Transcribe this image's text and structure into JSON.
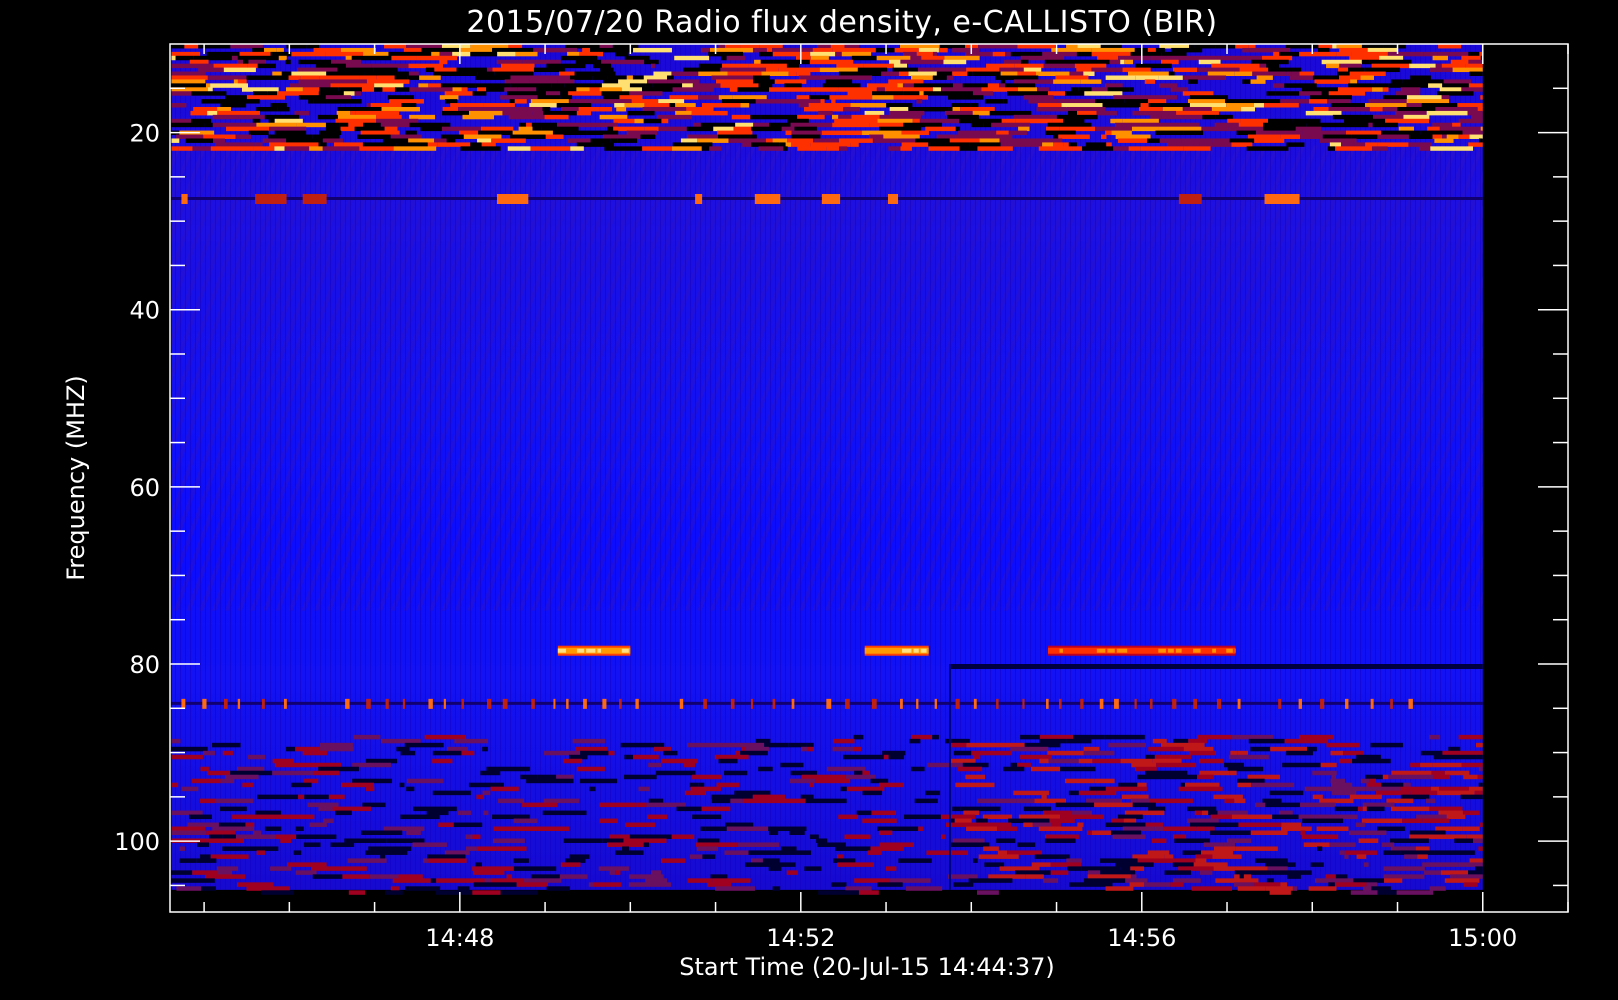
{
  "chart_data": {
    "type": "heatmap",
    "title": "2015/07/20  Radio flux density, e-CALLISTO (BIR)",
    "xlabel": "Start Time (20-Jul-15 14:44:37)",
    "ylabel": "Frequency (MHZ)",
    "x_ticks": [
      "14:48",
      "14:52",
      "14:56",
      "15:00"
    ],
    "x_tick_minutes": [
      48,
      52,
      56,
      60
    ],
    "y_ticks": [
      20,
      40,
      60,
      80,
      100
    ],
    "xlim_minutes": [
      44.6,
      61.0
    ],
    "ylim": [
      10,
      108
    ],
    "data_extent": {
      "t_start_min": 44.617,
      "t_end_min": 60.0,
      "f_min": 10.0,
      "f_max": 105.5
    },
    "y_inverted": true,
    "grid": false,
    "colormap": [
      "#000000",
      "#0000ff",
      "#2424ff",
      "#800040",
      "#ff2000",
      "#ff9000",
      "#ffff80"
    ],
    "features": [
      {
        "kind": "interference-band",
        "freq_mhz": [
          10,
          22
        ],
        "intensity": "high",
        "extent": "full"
      },
      {
        "kind": "interference-line",
        "freq_mhz": 27.5,
        "intensity": "high",
        "extent": "intermittent"
      },
      {
        "kind": "emission-segment",
        "freq_mhz": 78.5,
        "t_start_min": 49.15,
        "t_end_min": 50.0,
        "intensity": "very-high"
      },
      {
        "kind": "emission-segment",
        "freq_mhz": 78.5,
        "t_start_min": 52.75,
        "t_end_min": 53.5,
        "intensity": "very-high"
      },
      {
        "kind": "emission-segment",
        "freq_mhz": 78.5,
        "t_start_min": 54.9,
        "t_end_min": 57.1,
        "intensity": "high"
      },
      {
        "kind": "interference-line",
        "freq_mhz": 84.5,
        "intensity": "medium",
        "extent": "dashed"
      },
      {
        "kind": "interference-band",
        "freq_mhz": [
          88,
          106
        ],
        "intensity": "medium",
        "extent": "full"
      },
      {
        "kind": "receiver-change",
        "t_min": 53.75,
        "note": "background level steps at this time"
      }
    ]
  }
}
